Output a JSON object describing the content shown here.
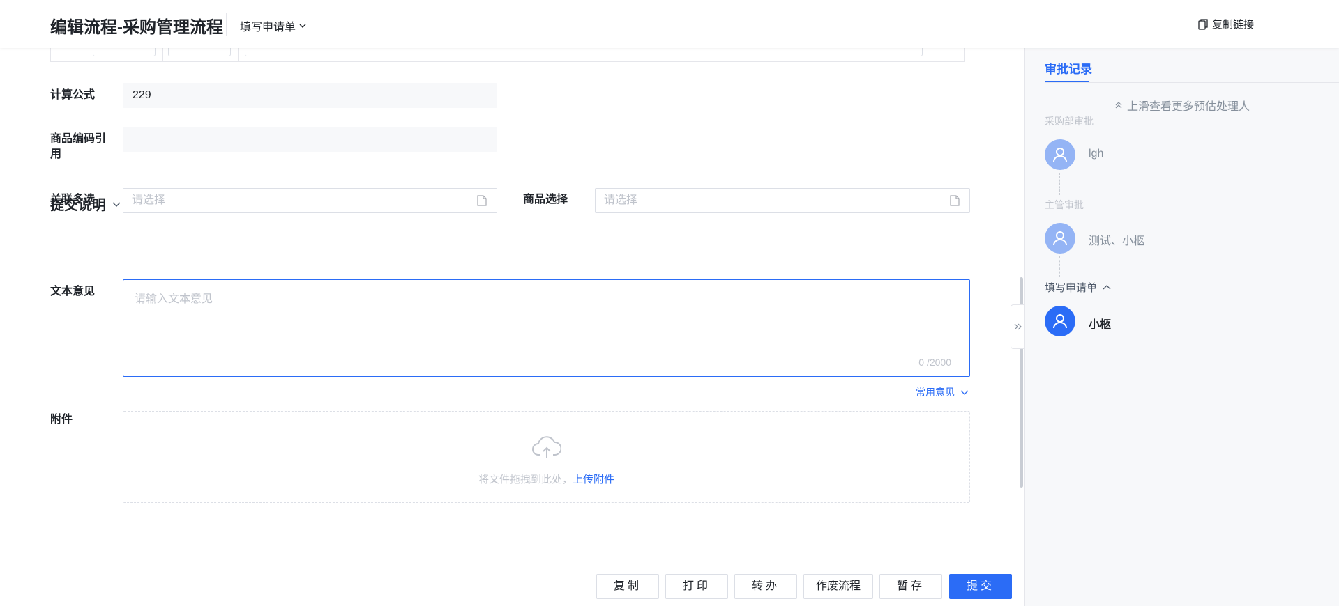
{
  "header": {
    "title": "编辑流程-采购管理流程",
    "stage": "填写申请单",
    "copy_link": "复制链接"
  },
  "form": {
    "formula": {
      "label": "计算公式",
      "value": "229"
    },
    "code_ref": {
      "label_line1": "商品编码引",
      "label_line2": "用",
      "value": ""
    },
    "multi_select": {
      "label": "关联多选",
      "placeholder": "请选择"
    },
    "product_select": {
      "label": "商品选择",
      "placeholder": "请选择"
    },
    "section_title": "提交说明",
    "opinion": {
      "label": "文本意见",
      "placeholder": "请输入文本意见",
      "count": "0 /2000"
    },
    "common_opinion": "常用意见",
    "attachment": {
      "label": "附件",
      "hint": "将文件拖拽到此处，",
      "upload_link": "上传附件"
    }
  },
  "actions": {
    "copy": "复制",
    "print": "打印",
    "transfer": "转办",
    "void": "作废流程",
    "save": "暂存",
    "submit": "提交"
  },
  "side": {
    "tab": "审批记录",
    "more": "上滑查看更多预估处理人",
    "nodes": [
      {
        "title": "采购部审批",
        "name": "lgh"
      },
      {
        "title": "主管审批",
        "name": "测试、小柩"
      },
      {
        "title": "填写申请单",
        "name": "小柩"
      }
    ]
  },
  "colors": {
    "accent": "#2b6cf6",
    "avatar_muted": "#94b4f5",
    "panel_bg": "#f7f8fa"
  },
  "icons": [
    "chevron-down-icon",
    "copy-icon",
    "document-icon",
    "cloud-upload-icon",
    "double-chevron-up-icon",
    "user-icon",
    "chevron-up-icon",
    "double-chevron-right-icon"
  ]
}
